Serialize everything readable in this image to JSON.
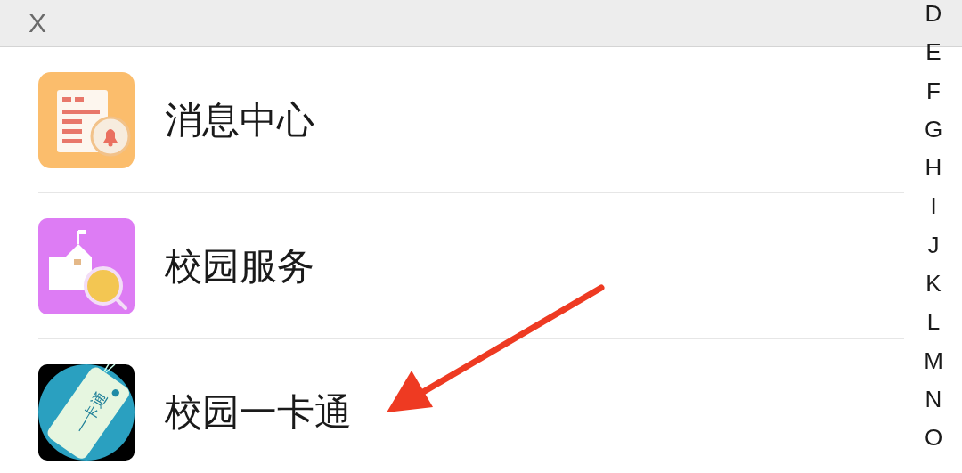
{
  "header": {
    "close": "X"
  },
  "items": [
    {
      "kind": "message",
      "label": "消息中心"
    },
    {
      "kind": "campus",
      "label": "校园服务"
    },
    {
      "kind": "card",
      "label": "校园一卡通",
      "icon_text": "一卡通"
    }
  ],
  "index_letters": [
    "D",
    "E",
    "F",
    "G",
    "H",
    "I",
    "J",
    "K",
    "L",
    "M",
    "N",
    "O"
  ],
  "annotation": {
    "kind": "arrow"
  }
}
